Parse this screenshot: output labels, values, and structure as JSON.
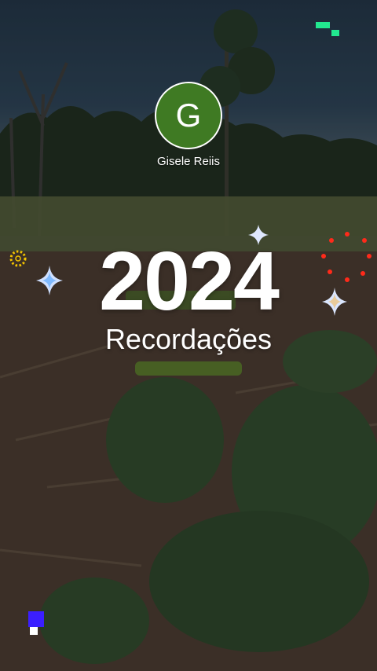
{
  "profile": {
    "avatar_letter": "G",
    "name": "Gisele Reiis"
  },
  "story": {
    "year": "2024",
    "subtitle": "Recordações"
  },
  "icons": {
    "sparkle": "sparkle-icon",
    "sun_ring": "dotted-ring-icon",
    "firework": "firework-dots-icon",
    "pixel": "pixel-squares-icon"
  },
  "colors": {
    "avatar_bg": "#3f7a23",
    "text": "#ffffff",
    "pixel_green": "#22e88f",
    "pixel_blue": "#3b1fff",
    "firework_red": "#ff2a1a",
    "ring_yellow": "#f3c400"
  }
}
